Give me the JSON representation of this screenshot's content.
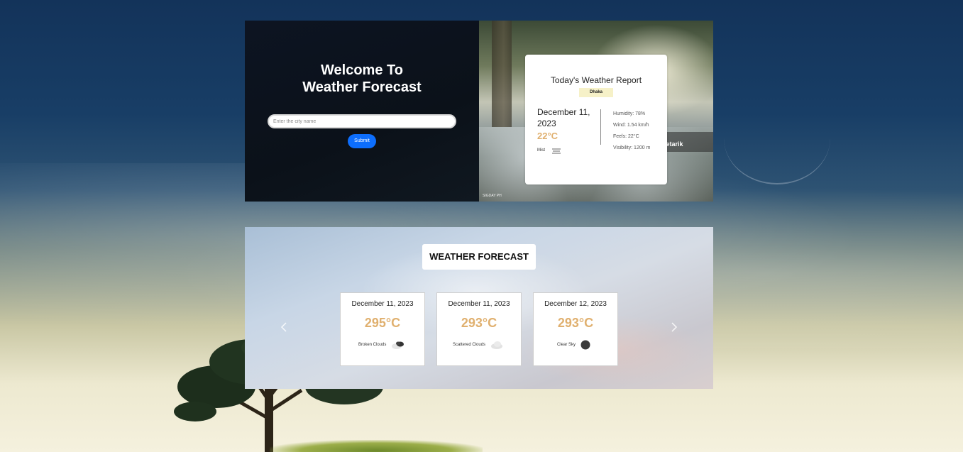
{
  "welcome": {
    "title_line1": "Welcome To",
    "title_line2": "Weather Forecast",
    "city_placeholder": "Enter the city name",
    "submit_label": "Submit"
  },
  "photo": {
    "watermark": "retarik",
    "caption": "SIGDAY PH"
  },
  "report": {
    "title": "Today's Weather Report",
    "city": "Dhaka",
    "date": "December 11, 2023",
    "temperature": "22°C",
    "condition": "Mist",
    "condition_icon": "mist-icon",
    "humidity": "Humidity: 78%",
    "wind": "Wind: 1.54 km/h",
    "feels": "Feels: 22°C",
    "visibility": "Visibility: 1200 m"
  },
  "forecast": {
    "heading": "WEATHER FORECAST",
    "prev_icon": "chevron-left-icon",
    "next_icon": "chevron-right-icon",
    "cards": [
      {
        "date": "December 11, 2023",
        "temp": "295°C",
        "condition": "Broken Clouds",
        "icon": "broken-clouds-icon"
      },
      {
        "date": "December 11, 2023",
        "temp": "293°C",
        "condition": "Scattered Clouds",
        "icon": "scattered-clouds-icon"
      },
      {
        "date": "December 12, 2023",
        "temp": "293°C",
        "condition": "Clear Sky",
        "icon": "clear-sky-icon"
      }
    ]
  },
  "colors": {
    "accent_temp": "#e0b06f",
    "submit_button": "#0d6efd",
    "city_badge": "#f6f1c8"
  }
}
